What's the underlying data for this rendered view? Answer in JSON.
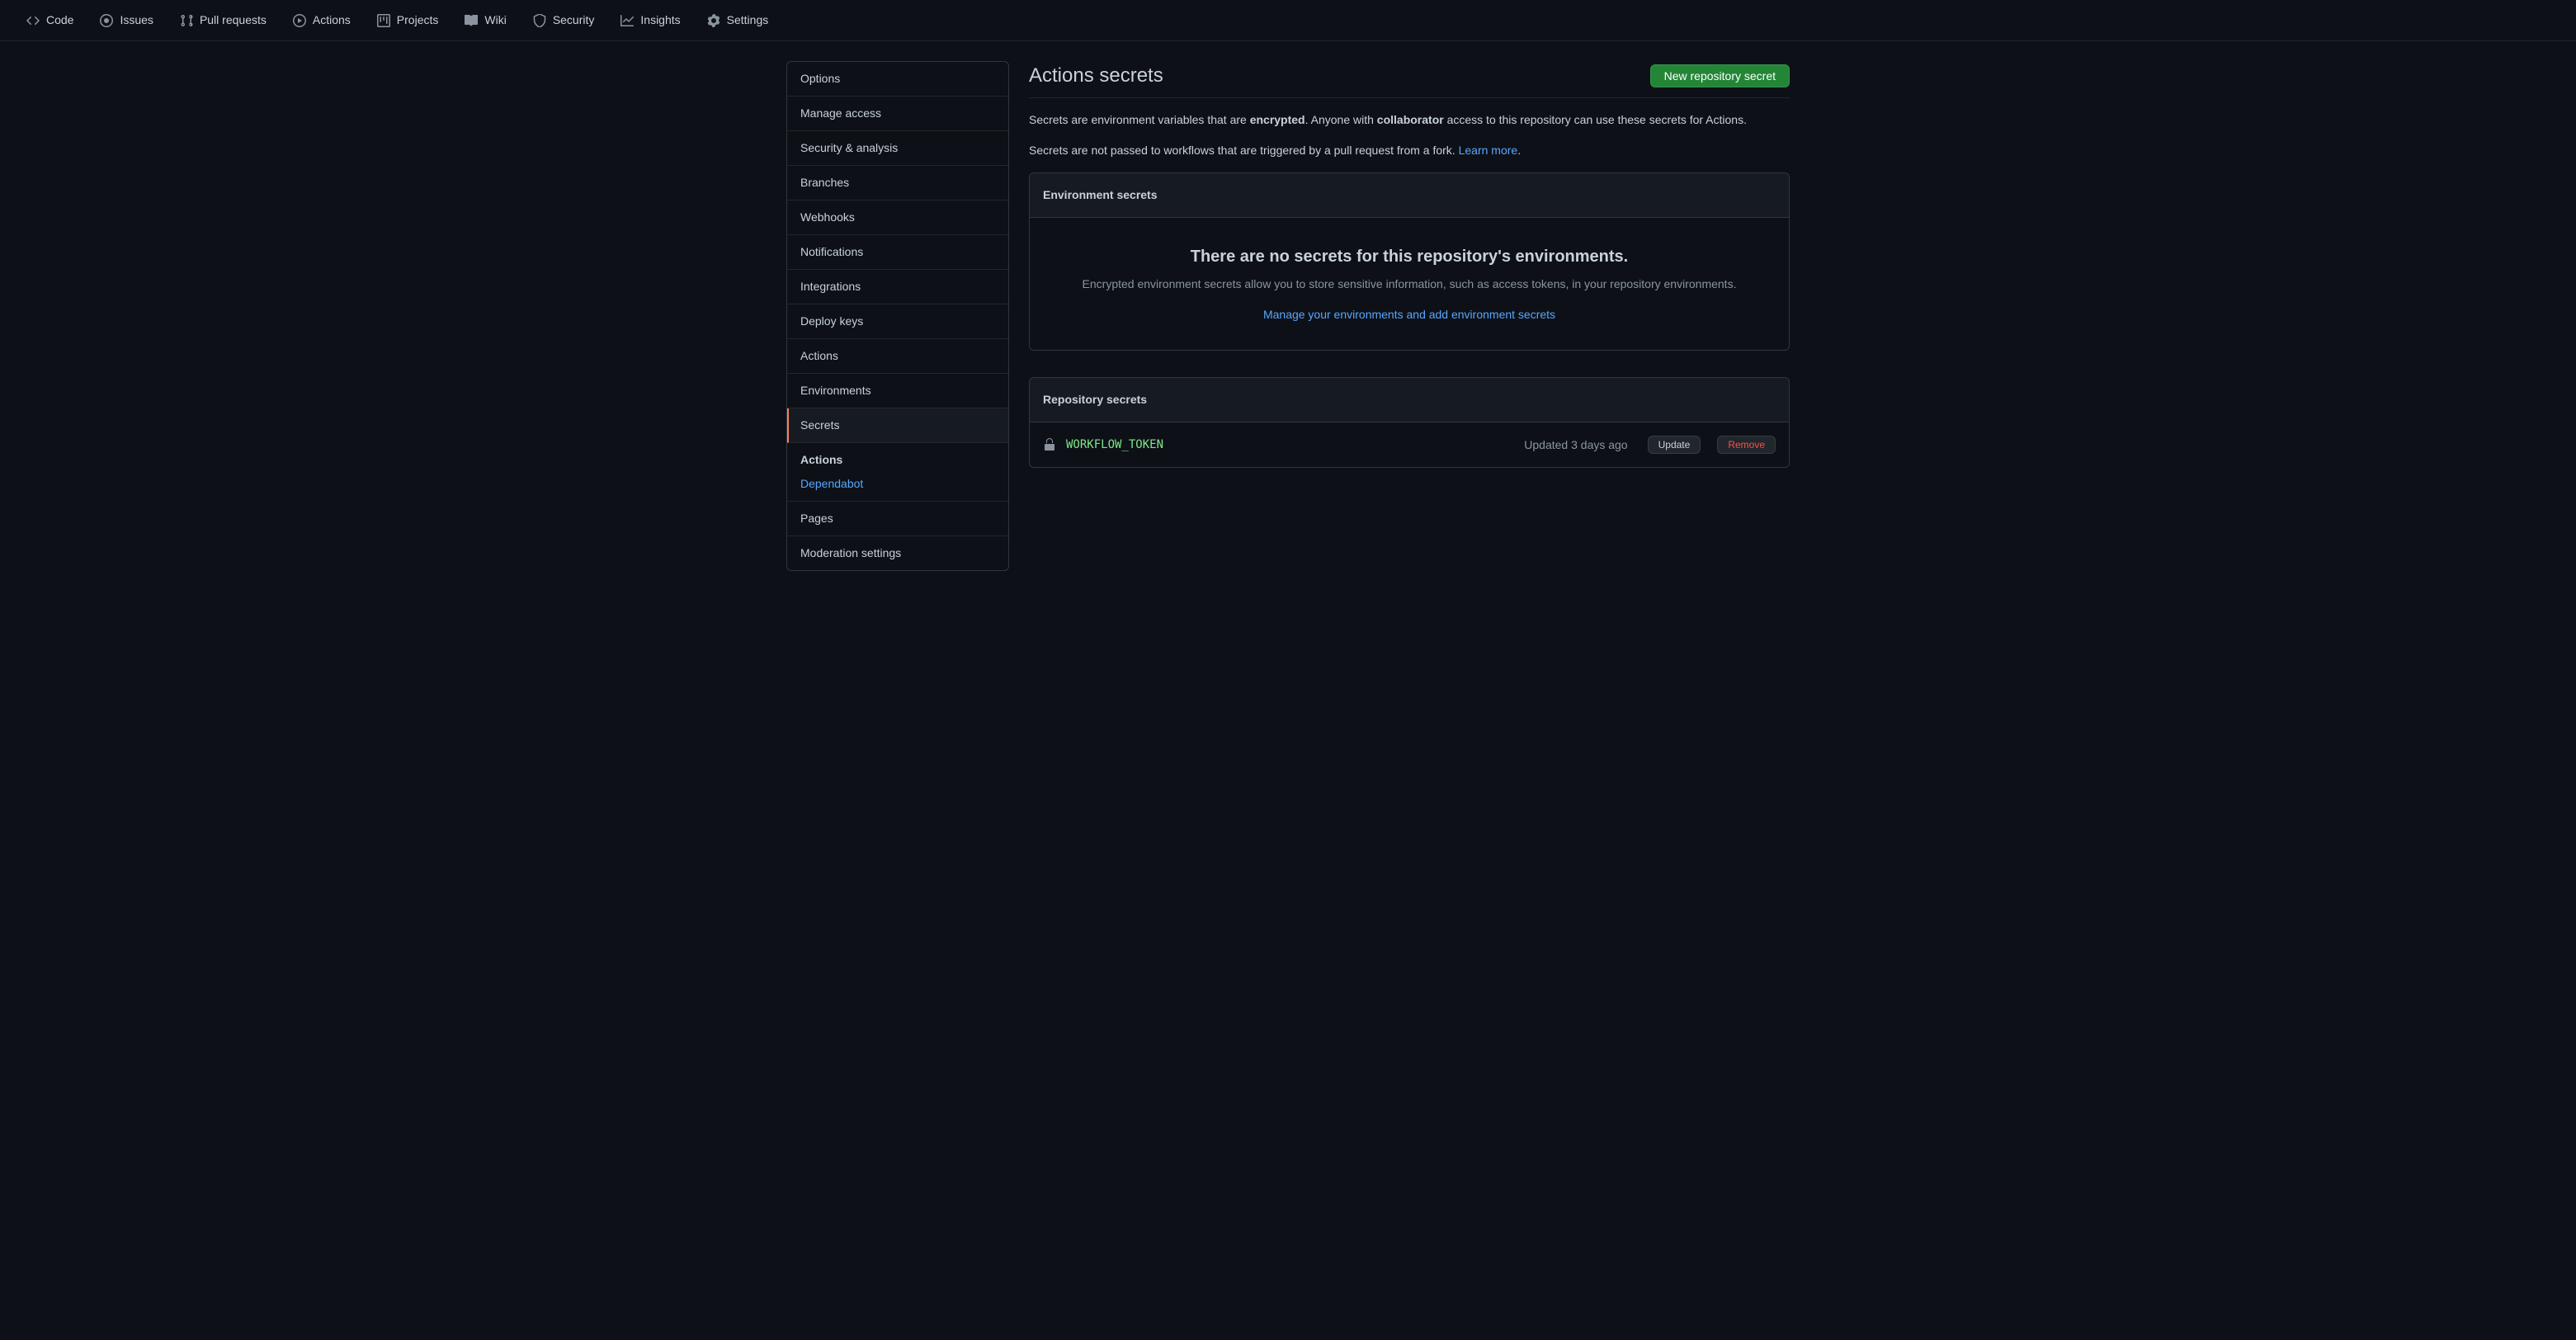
{
  "topNav": {
    "code": "Code",
    "issues": "Issues",
    "pullRequests": "Pull requests",
    "actions": "Actions",
    "projects": "Projects",
    "wiki": "Wiki",
    "security": "Security",
    "insights": "Insights",
    "settings": "Settings"
  },
  "sidebar": {
    "options": "Options",
    "manageAccess": "Manage access",
    "securityAnalysis": "Security & analysis",
    "branches": "Branches",
    "webhooks": "Webhooks",
    "notifications": "Notifications",
    "integrations": "Integrations",
    "deployKeys": "Deploy keys",
    "actions": "Actions",
    "environments": "Environments",
    "secrets": "Secrets",
    "secretsSubTitle": "Actions",
    "dependabot": "Dependabot",
    "pages": "Pages",
    "moderation": "Moderation settings"
  },
  "header": {
    "title": "Actions secrets",
    "newSecretBtn": "New repository secret"
  },
  "description": {
    "part1": "Secrets are environment variables that are ",
    "encrypted": "encrypted",
    "part2": ". Anyone with ",
    "collaborator": "collaborator",
    "part3": " access to this repository can use these secrets for Actions.",
    "line2a": "Secrets are not passed to workflows that are triggered by a pull request from a fork. ",
    "learnMore": "Learn more",
    "period": "."
  },
  "envSecrets": {
    "header": "Environment secrets",
    "emptyTitle": "There are no secrets for this repository's environments.",
    "emptyDesc": "Encrypted environment secrets allow you to store sensitive information, such as access tokens, in your repository environments.",
    "manageLink": "Manage your environments and add environment secrets"
  },
  "repoSecrets": {
    "header": "Repository secrets",
    "secret": {
      "name": "WORKFLOW_TOKEN",
      "updated": "Updated 3 days ago",
      "updateBtn": "Update",
      "removeBtn": "Remove"
    }
  }
}
